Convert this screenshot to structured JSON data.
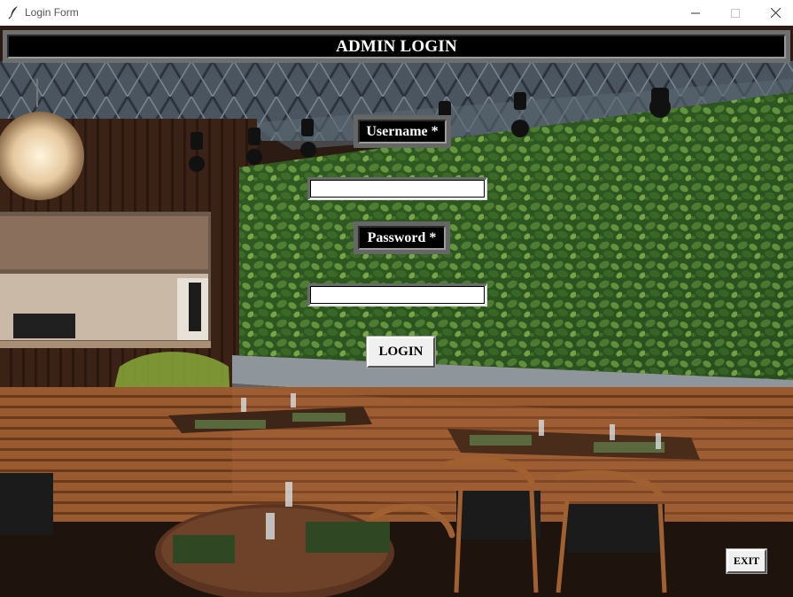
{
  "window": {
    "title": "Login Form",
    "controls": [
      "minimize",
      "maximize",
      "close"
    ]
  },
  "header": {
    "title": "ADMIN LOGIN"
  },
  "form": {
    "username_label": "Username *",
    "username_value": "",
    "password_label": "Password *",
    "password_value": "",
    "login_button": "LOGIN"
  },
  "exit_button": "EXIT",
  "colors": {
    "header_bg": "#000000",
    "header_frame": "#6e6e6e",
    "label_bg": "#000000",
    "label_frame": "#666666",
    "button_bg": "#f0f0f0",
    "background_theme": "restaurant interior with green living wall"
  }
}
